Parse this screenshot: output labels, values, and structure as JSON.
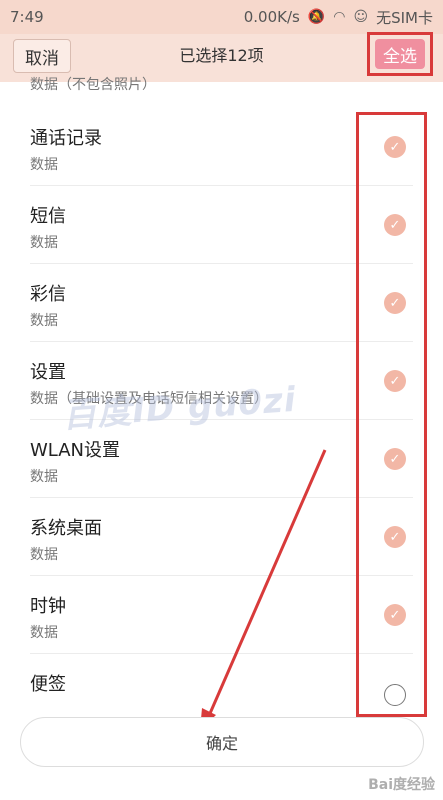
{
  "status": {
    "time": "7:49",
    "speed": "0.00K/s",
    "sim": "无SIM卡"
  },
  "header": {
    "cancel": "取消",
    "title": "已选择12项",
    "select_all": "全选"
  },
  "partial_item_desc": "数据（不包含照片）",
  "items": [
    {
      "name": "通话记录",
      "desc": "数据",
      "checked": true
    },
    {
      "name": "短信",
      "desc": "数据",
      "checked": true
    },
    {
      "name": "彩信",
      "desc": "数据",
      "checked": true
    },
    {
      "name": "设置",
      "desc": "数据（基础设置及电话短信相关设置）",
      "checked": true
    },
    {
      "name": "WLAN设置",
      "desc": "数据",
      "checked": true
    },
    {
      "name": "系统桌面",
      "desc": "数据",
      "checked": true
    },
    {
      "name": "时钟",
      "desc": "数据",
      "checked": true
    },
    {
      "name": "便签",
      "desc": "",
      "checked": false
    }
  ],
  "watermark": "百度ID gu0zi",
  "footer": {
    "confirm": "确定"
  },
  "corner_watermark": "Bai度经验"
}
